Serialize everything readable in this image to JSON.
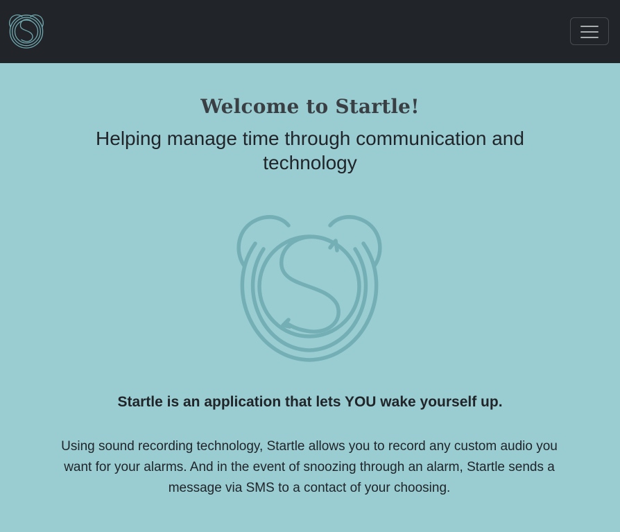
{
  "nav": {
    "logo_icon": "startle-alarm-clock-logo",
    "menu_icon": "hamburger-menu-icon",
    "background_color": "#212529"
  },
  "hero": {
    "welcome_title": "Welcome to Startle!",
    "tagline": "Helping manage time through communication and technology",
    "logo_icon": "startle-alarm-clock-logo",
    "logo_color": "#74afb6"
  },
  "content": {
    "lead": "Startle is an application that lets YOU wake yourself up.",
    "description": "Using sound recording technology, Startle allows you to record any custom audio you want for your alarms. And in the event of snoozing through an alarm, Startle sends a message via SMS to a contact of your choosing."
  },
  "theme": {
    "page_background": "#99cdd2",
    "text_color": "#212529"
  }
}
